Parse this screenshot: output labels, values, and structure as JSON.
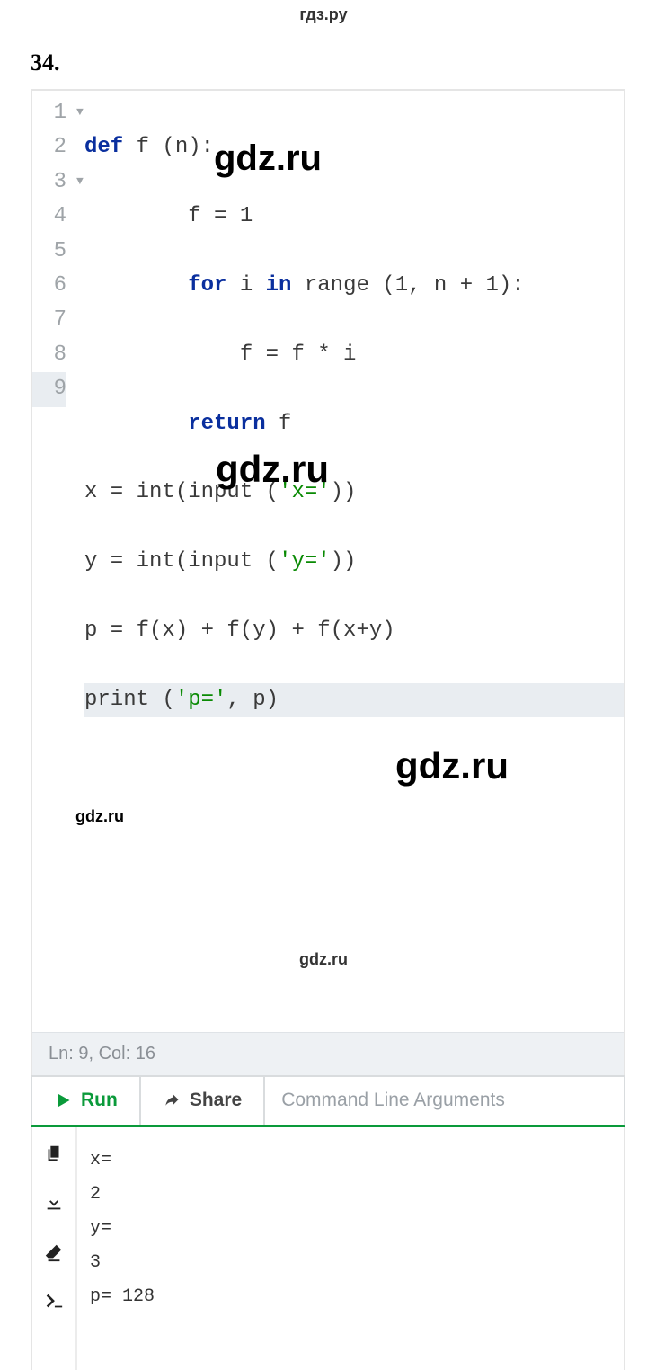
{
  "site": {
    "header": "гдз.ру",
    "footer": "gdz.ru"
  },
  "problem": {
    "number": "34."
  },
  "editor": {
    "lines": {
      "n1": "1",
      "n2": "2",
      "n3": "3",
      "n4": "4",
      "n5": "5",
      "n6": "6",
      "n7": "7",
      "n8": "8",
      "n9": "9"
    },
    "code": {
      "l1_kw": "def",
      "l1_rest": " f (n):",
      "l2": "        f = 1",
      "l3_kw1": "for",
      "l3_mid": " i ",
      "l3_kw2": "in",
      "l3_rest": " range (1, n + 1):",
      "l4": "            f = f * i",
      "l5_kw": "return",
      "l5_rest": " f",
      "l6_a": "x = int(input (",
      "l6_s": "'x='",
      "l6_b": "))",
      "l7_a": "y = int(input (",
      "l7_s": "'y='",
      "l7_b": "))",
      "l8": "p = f(x) + f(y) + f(x+y)",
      "l9_a": "print (",
      "l9_s": "'p='",
      "l9_b": ", p)"
    },
    "status": "Ln: 9,  Col: 16"
  },
  "toolbar": {
    "run": "Run",
    "share": "Share",
    "cli_placeholder": "Command Line Arguments"
  },
  "console": {
    "out": "x=\n2\ny=\n3\np= 128"
  },
  "watermarks": {
    "big": "gdz.ru",
    "small": "gdz.ru"
  }
}
